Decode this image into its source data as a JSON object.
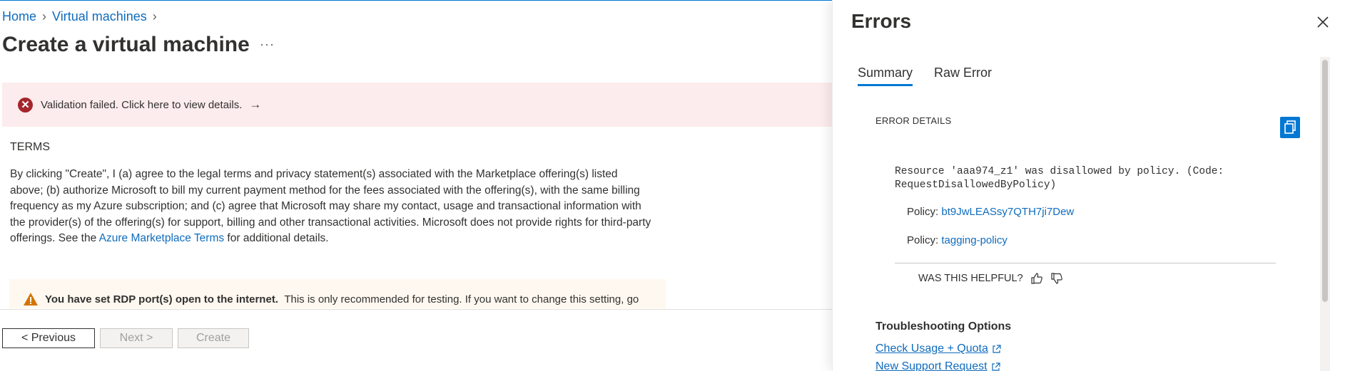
{
  "breadcrumb": {
    "home": "Home",
    "virtual_machines": "Virtual machines"
  },
  "page": {
    "title": "Create a virtual machine",
    "more": "···"
  },
  "banner": {
    "message": "Validation failed. Click here to view details.",
    "arrow": "→"
  },
  "terms": {
    "heading": "TERMS",
    "text_before_link": "By clicking \"Create\", I (a) agree to the legal terms and privacy statement(s) associated with the Marketplace offering(s) listed above; (b) authorize Microsoft to bill my current payment method for the fees associated with the offering(s), with the same billing frequency as my Azure subscription; and (c) agree that Microsoft may share my contact, usage and transactional information with the provider(s) of the offering(s) for support, billing and other transactional activities. Microsoft does not provide rights for third-party offerings. See the ",
    "link": "Azure Marketplace Terms",
    "text_after_link": " for additional details."
  },
  "warning": {
    "bold": "You have set RDP port(s) open to the internet.",
    "text": "This is only recommended for testing.  If you want to change this setting, go"
  },
  "footer": {
    "previous": "< Previous",
    "next": "Next >",
    "create": "Create"
  },
  "errors_panel": {
    "title": "Errors",
    "tabs": [
      "Summary",
      "Raw Error"
    ],
    "section_label": "ERROR DETAILS",
    "error_line1": "Resource 'aaa974_z1' was disallowed by policy. (Code:",
    "error_line2": "RequestDisallowedByPolicy)",
    "policy_label": "Policy:",
    "policy1": "bt9JwLEASsy7QTH7ji7Dew",
    "policy2": "tagging-policy",
    "helpful": "WAS THIS HELPFUL?",
    "troubleshooting_heading": "Troubleshooting Options",
    "links": [
      "Check Usage + Quota",
      "New Support Request"
    ]
  },
  "colors": {
    "accent": "#0078d4",
    "link": "#0f6cbd",
    "error": "#a4262c",
    "error_bg": "#fdeced",
    "warning": "#d47500",
    "warning_bg": "#fff8f0"
  }
}
